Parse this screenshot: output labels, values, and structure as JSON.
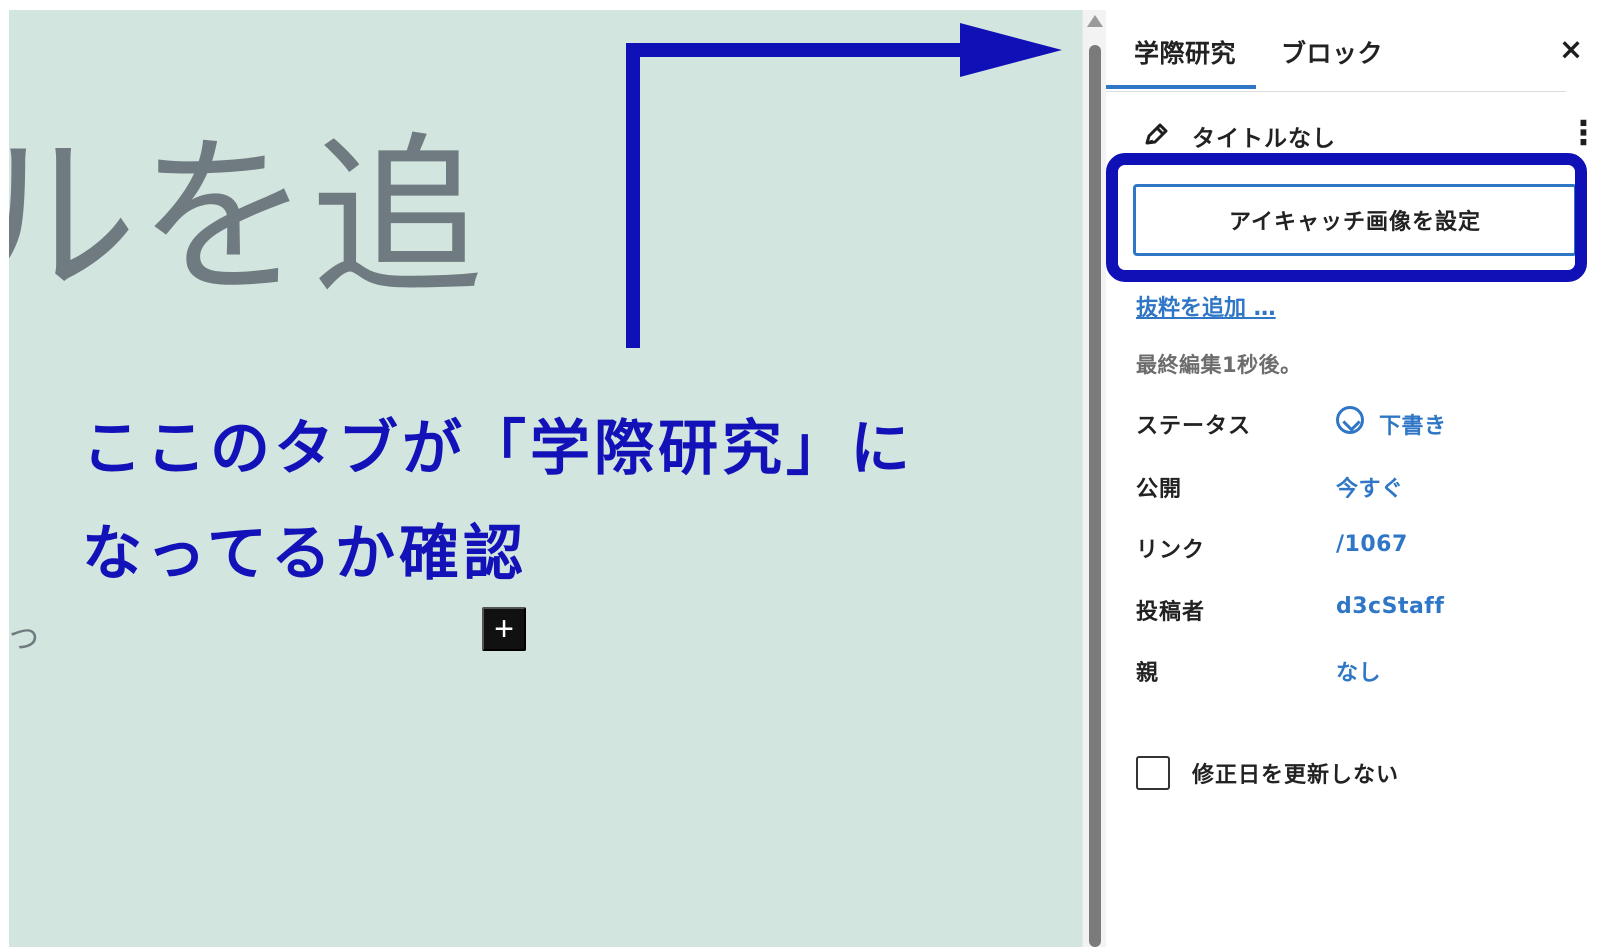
{
  "editor": {
    "title_fragment": "ルを追",
    "small_fragment": "つ",
    "add_block_label": "+"
  },
  "annotation": {
    "line1": "ここのタブが「学際研究」に",
    "line2": "なってるか確認",
    "color": "#1212b8"
  },
  "sidebar": {
    "tabs": [
      {
        "label": "学際研究",
        "active": true
      },
      {
        "label": "ブロック",
        "active": false
      }
    ],
    "close_icon": "close-icon",
    "title_row": {
      "icon": "pencil-icon",
      "label": "タイトルなし",
      "more_icon": "more-vertical-icon"
    },
    "featured_image_button": "アイキャッチ画像を設定",
    "excerpt_link": "抜粋を追加 …",
    "last_edited": "最終編集1秒後。",
    "meta": [
      {
        "label": "ステータス",
        "value": "下書き",
        "icon": "draft-status-icon"
      },
      {
        "label": "公開",
        "value": "今すぐ"
      },
      {
        "label": "リンク",
        "value": "/1067"
      },
      {
        "label": "投稿者",
        "value": "d3cStaff"
      },
      {
        "label": "親",
        "value": "なし"
      }
    ],
    "checkbox_label": "修正日を更新しない"
  },
  "colors": {
    "editor_background": "#d2e5df",
    "accent_blue": "#2f77c6",
    "annotation_blue": "#1010b7"
  }
}
